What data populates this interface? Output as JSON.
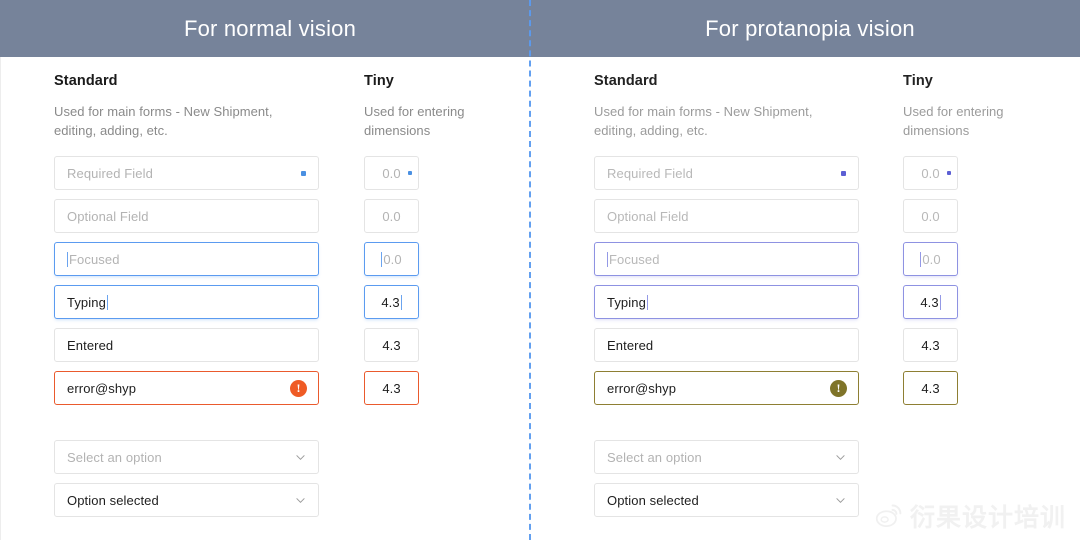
{
  "headers": [
    {
      "title": "For normal vision"
    },
    {
      "title": "For protanopia vision"
    }
  ],
  "colors": {
    "header_bg": "#76839a",
    "divider": "#5b9bf0",
    "normal_focus_blue": "#5b9bf0",
    "normal_required_dot": "#4a90e2",
    "normal_error": "#ea5a2d",
    "protanopia_focus_blue": "#8e92e2",
    "protanopia_required_dot": "#5c5fd4",
    "protanopia_error": "#8e7f33",
    "border_grey": "#e4e4e4",
    "placeholder_grey": "#b3b3b3",
    "text_dark": "#1e1e1e",
    "desc_grey": "#8a8a8a"
  },
  "columns": {
    "standard": {
      "title": "Standard",
      "description": "Used for main forms - New Shipment, editing, adding, etc.",
      "fields": [
        {
          "state": "required",
          "value": "Required Field",
          "is_placeholder": true,
          "has_required_dot": true,
          "caret": "none"
        },
        {
          "state": "optional",
          "value": "Optional Field",
          "is_placeholder": true,
          "has_required_dot": false,
          "caret": "none"
        },
        {
          "state": "focused",
          "value": "Focused",
          "is_placeholder": true,
          "has_required_dot": false,
          "caret": "lead"
        },
        {
          "state": "typing",
          "value": "Typing",
          "is_placeholder": false,
          "has_required_dot": false,
          "caret": "trail"
        },
        {
          "state": "entered",
          "value": "Entered",
          "is_placeholder": false,
          "has_required_dot": false,
          "caret": "none"
        },
        {
          "state": "error",
          "value": "error@shyp",
          "is_placeholder": false,
          "has_required_dot": false,
          "caret": "none",
          "has_error_icon": true
        }
      ],
      "selects": [
        {
          "value": "Select an option",
          "is_placeholder": true
        },
        {
          "value": "Option selected",
          "is_placeholder": false
        }
      ]
    },
    "tiny": {
      "title": "Tiny",
      "description": "Used for entering dimensions",
      "fields": [
        {
          "state": "required",
          "value": "0.0",
          "is_placeholder": true,
          "has_required_dot": true,
          "caret": "none"
        },
        {
          "state": "optional",
          "value": "0.0",
          "is_placeholder": true,
          "has_required_dot": false,
          "caret": "none"
        },
        {
          "state": "focused",
          "value": "0.0",
          "is_placeholder": true,
          "has_required_dot": false,
          "caret": "lead"
        },
        {
          "state": "typing",
          "value": "4.3",
          "is_placeholder": false,
          "has_required_dot": false,
          "caret": "trail"
        },
        {
          "state": "entered",
          "value": "4.3",
          "is_placeholder": false,
          "has_required_dot": false,
          "caret": "none"
        },
        {
          "state": "error",
          "value": "4.3",
          "is_placeholder": false,
          "has_required_dot": false,
          "caret": "none"
        }
      ]
    }
  },
  "icons": {
    "error_glyph": "!",
    "chevron": "chevron-down-icon"
  },
  "watermark": {
    "text": "衍果设计培训",
    "logo": "weibo-logo-icon"
  }
}
